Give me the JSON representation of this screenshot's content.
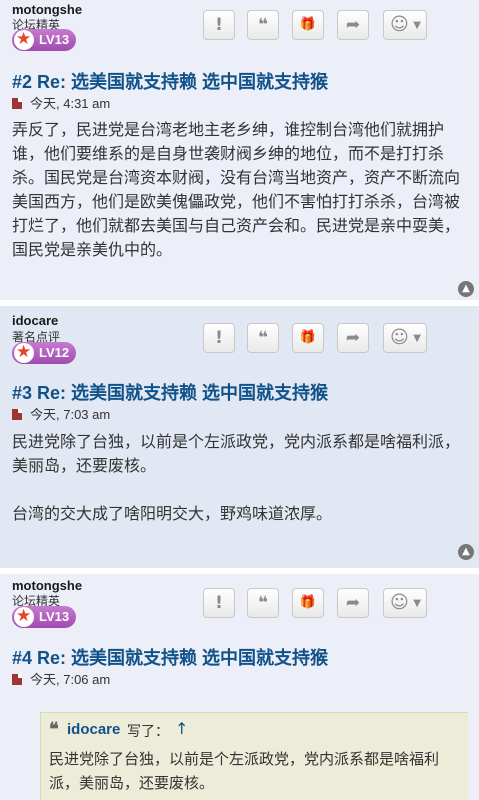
{
  "posts": [
    {
      "author": "motongshe",
      "rank": "论坛精英",
      "level": "LV13",
      "title": "#2 Re: 选美国就支持赖 选中国就支持猴",
      "time": "今天, 4:31 am",
      "paragraphs": [
        "弄反了，民进党是台湾老地主老乡绅，谁控制台湾他们就拥护谁，他们要维系的是自身世袭财阀乡绅的地位，而不是打打杀杀。国民党是台湾资本财阀，没有台湾当地资产，资产不断流向美国西方，他们是欧美傀儡政党，他们不害怕打打杀杀，台湾被打烂了，他们就都去美国与自己资产会和。民进党是亲中耍美，国民党是亲美仇中的。"
      ]
    },
    {
      "author": "idocare",
      "rank": "著名点评",
      "level": "LV12",
      "title": "#3 Re: 选美国就支持赖 选中国就支持猴",
      "time": "今天, 7:03 am",
      "paragraphs": [
        "民进党除了台独，以前是个左派政党，党内派系都是啥福利派，美丽岛，还要废核。",
        "台湾的交大成了啥阳明交大，野鸡味道浓厚。"
      ]
    },
    {
      "author": "motongshe",
      "rank": "论坛精英",
      "level": "LV13",
      "title": "#4 Re: 选美国就支持赖 选中国就支持猴",
      "time": "今天, 7:06 am",
      "quote": {
        "author": "idocare",
        "said": "写了：",
        "arrow": "↑",
        "text": "民进党除了台独，以前是个左派政党，党内派系都是啥福利派，美丽岛，还要废核。"
      }
    }
  ],
  "buttons": {
    "report": "!",
    "quote": "❝",
    "gift": "🎁",
    "share": "➦",
    "emoji": "☺",
    "caret": "▼"
  },
  "top_icon": "▲"
}
